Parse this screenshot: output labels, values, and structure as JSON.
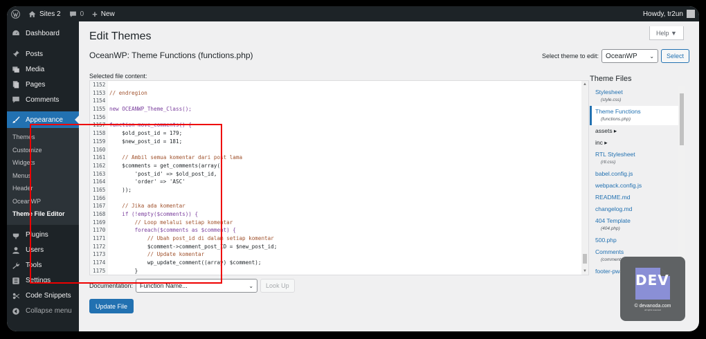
{
  "adminbar": {
    "site_name": "Sites 2",
    "comments_count": "0",
    "new_label": "New",
    "howdy": "Howdy, tr2un"
  },
  "sidebar": {
    "items": [
      {
        "label": "Dashboard",
        "icon": "dashboard-icon"
      },
      {
        "label": "Posts",
        "icon": "pin-icon"
      },
      {
        "label": "Media",
        "icon": "media-icon"
      },
      {
        "label": "Pages",
        "icon": "pages-icon"
      },
      {
        "label": "Comments",
        "icon": "comment-icon"
      },
      {
        "label": "Appearance",
        "icon": "brush-icon"
      }
    ],
    "submenu": [
      "Themes",
      "Customize",
      "Widgets",
      "Menus",
      "Header",
      "OceanWP",
      "Theme File Editor"
    ],
    "lower_items": [
      {
        "label": "Plugins",
        "icon": "plug-icon"
      },
      {
        "label": "Users",
        "icon": "users-icon"
      },
      {
        "label": "Tools",
        "icon": "wrench-icon"
      },
      {
        "label": "Settings",
        "icon": "settings-icon"
      },
      {
        "label": "Code Snippets",
        "icon": "snippets-icon"
      },
      {
        "label": "Collapse menu",
        "icon": "collapse-icon"
      }
    ]
  },
  "main": {
    "help_label": "Help ▼",
    "page_title": "Edit Themes",
    "file_title": "OceanWP: Theme Functions (functions.php)",
    "selected_label": "Selected file content:",
    "theme_select_label": "Select theme to edit:",
    "theme_select_value": "OceanWP",
    "select_button": "Select",
    "documentation_label": "Documentation:",
    "documentation_value": "Function Name...",
    "lookup_button": "Look Up",
    "update_button": "Update File"
  },
  "code_lines": [
    {
      "n": "1152",
      "t": ""
    },
    {
      "n": "1153",
      "t": "// endregion"
    },
    {
      "n": "1154",
      "t": ""
    },
    {
      "n": "1155",
      "t": "new OCEANWP_Theme_Class();"
    },
    {
      "n": "1156",
      "t": ""
    },
    {
      "n": "1157",
      "t": "function move_comments() {"
    },
    {
      "n": "1158",
      "t": "    $old_post_id = 179;"
    },
    {
      "n": "1159",
      "t": "    $new_post_id = 181;"
    },
    {
      "n": "1160",
      "t": ""
    },
    {
      "n": "1161",
      "t": "    // Ambil semua komentar dari post lama"
    },
    {
      "n": "1162",
      "t": "    $comments = get_comments(array("
    },
    {
      "n": "1163",
      "t": "        'post_id' => $old_post_id,"
    },
    {
      "n": "1164",
      "t": "        'order' => 'ASC'"
    },
    {
      "n": "1165",
      "t": "    ));"
    },
    {
      "n": "1166",
      "t": ""
    },
    {
      "n": "1167",
      "t": "    // Jika ada komentar"
    },
    {
      "n": "1168",
      "t": "    if (!empty($comments)) {"
    },
    {
      "n": "1169",
      "t": "        // Loop melalui setiap komentar"
    },
    {
      "n": "1170",
      "t": "        foreach($comments as $comment) {"
    },
    {
      "n": "1171",
      "t": "            // Ubah post_id di dalam setiap komentar"
    },
    {
      "n": "1172",
      "t": "            $comment->comment_post_ID = $new_post_id;"
    },
    {
      "n": "1173",
      "t": "            // Update komentar"
    },
    {
      "n": "1174",
      "t": "            wp_update_comment((array) $comment);"
    },
    {
      "n": "1175",
      "t": "        }"
    }
  ],
  "theme_files": {
    "title": "Theme Files",
    "items": [
      {
        "label": "Stylesheet",
        "sub": "(style.css)",
        "active": false,
        "folder": false
      },
      {
        "label": "Theme Functions",
        "sub": "(functions.php)",
        "active": true,
        "folder": false
      },
      {
        "label": "assets ▸",
        "sub": "",
        "active": false,
        "folder": true
      },
      {
        "label": "inc ▸",
        "sub": "",
        "active": false,
        "folder": true
      },
      {
        "label": "RTL Stylesheet",
        "sub": "(rtl.css)",
        "active": false,
        "folder": false
      },
      {
        "label": "babel.config.js",
        "sub": "",
        "active": false,
        "folder": false
      },
      {
        "label": "webpack.config.js",
        "sub": "",
        "active": false,
        "folder": false
      },
      {
        "label": "README.md",
        "sub": "",
        "active": false,
        "folder": false
      },
      {
        "label": "changelog.md",
        "sub": "",
        "active": false,
        "folder": false
      },
      {
        "label": "404 Template",
        "sub": "(404.php)",
        "active": false,
        "folder": false
      },
      {
        "label": "500.php",
        "sub": "",
        "active": false,
        "folder": false
      },
      {
        "label": "Comments",
        "sub": "(comments.php)",
        "active": false,
        "folder": false
      },
      {
        "label": "footer-pwa.php",
        "sub": "",
        "active": false,
        "folder": false
      }
    ]
  },
  "watermark": {
    "logo_text": "DEV",
    "caption": "© devanoda.com",
    "subcaption": "all rights reserved"
  },
  "colors": {
    "accent": "#2271b1",
    "sidebar_bg": "#1d2327",
    "highlight_border": "#ee0000"
  }
}
